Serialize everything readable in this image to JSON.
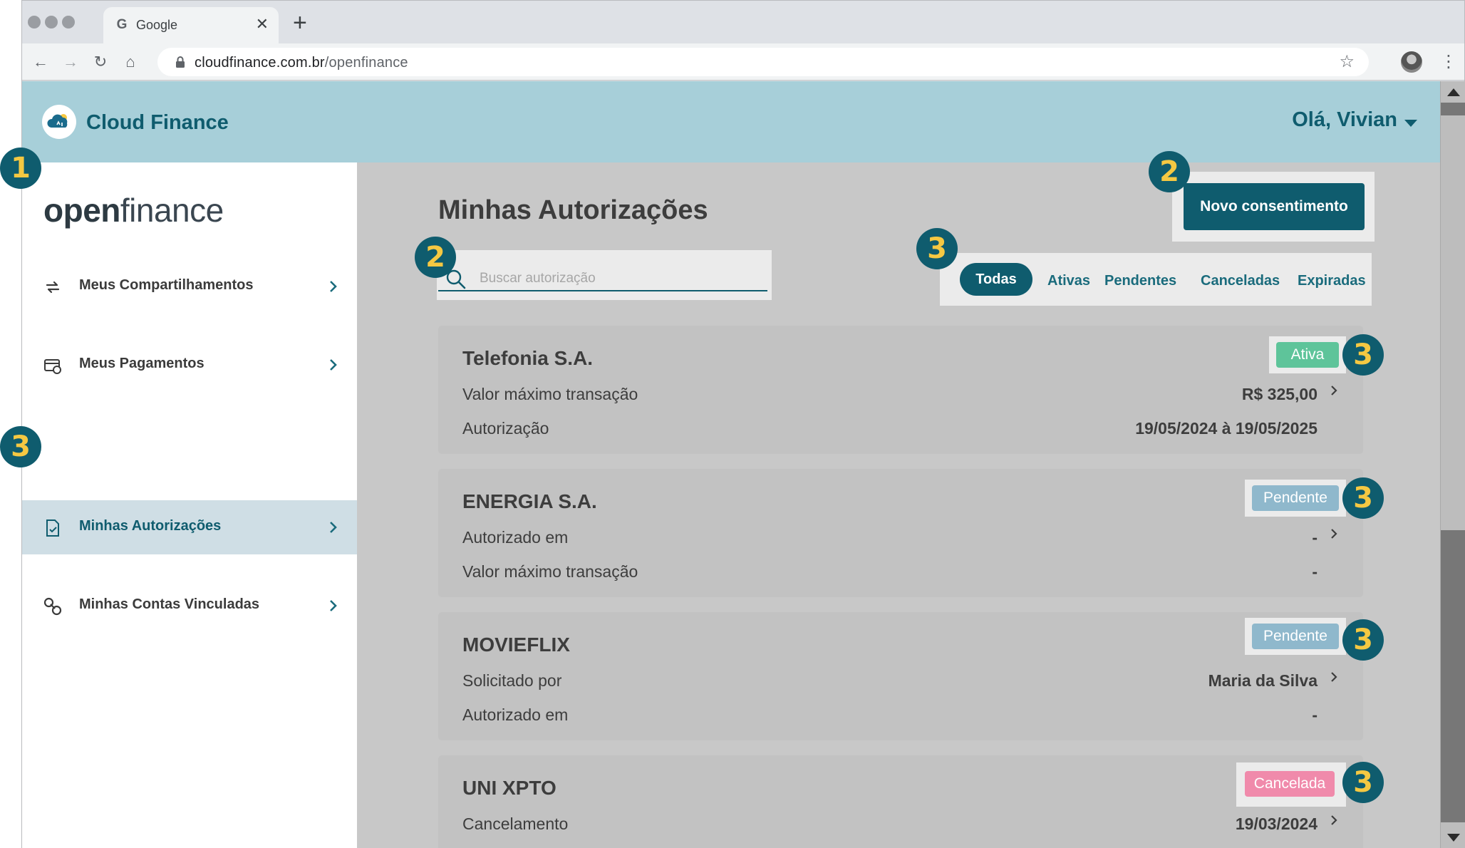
{
  "browser": {
    "tab_title": "Google",
    "tab_favicon": "G",
    "new_tab": "+",
    "url_domain": "cloudfinance.com.br",
    "url_path": "/openfinance"
  },
  "header": {
    "brand_name": "Cloud Finance",
    "greeting": "Olá, Vivian"
  },
  "sidebar": {
    "logo_bold": "open",
    "logo_light": "finance",
    "items": [
      {
        "label": "Meus Compartilhamentos",
        "icon": "arrows-sync-icon",
        "active": false
      },
      {
        "label": "Meus Pagamentos",
        "icon": "payment-icon",
        "active": false
      },
      {
        "label": "Minhas Autorizações",
        "icon": "document-check-icon",
        "active": true
      },
      {
        "label": "Minhas Contas Vinculadas",
        "icon": "link-icon",
        "active": false
      }
    ]
  },
  "main": {
    "title": "Minhas Autorizações",
    "new_button": "Novo consentimento",
    "search_placeholder": "Buscar autorização",
    "filters": [
      "Todas",
      "Ativas",
      "Pendentes",
      "Canceladas",
      "Expiradas"
    ],
    "active_filter": "Todas"
  },
  "cards": [
    {
      "title": "Telefonia S.A.",
      "status": "Ativa",
      "status_color": "#5ec49a",
      "rows": [
        {
          "label": "Valor máximo transação",
          "value": "R$ 325,00"
        },
        {
          "label": "Autorização",
          "value": "19/05/2024 à 19/05/2025"
        }
      ]
    },
    {
      "title": "ENERGIA S.A.",
      "status": "Pendente",
      "status_color": "#8fb8cc",
      "rows": [
        {
          "label": "Autorizado em",
          "value": "-"
        },
        {
          "label": "Valor máximo transação",
          "value": "-"
        }
      ]
    },
    {
      "title": "MOVIEFLIX",
      "status": "Pendente",
      "status_color": "#8fb8cc",
      "rows": [
        {
          "label": "Solicitado por",
          "value": "Maria da Silva"
        },
        {
          "label": "Autorizado em",
          "value": "-"
        }
      ]
    },
    {
      "title": "UNI XPTO",
      "status": "Cancelada",
      "status_color": "#f08aab",
      "rows": [
        {
          "label": "Cancelamento",
          "value": "19/03/2024"
        }
      ]
    }
  ],
  "markers": [
    "1",
    "2",
    "2",
    "3",
    "3",
    "3",
    "3",
    "3",
    "3"
  ]
}
